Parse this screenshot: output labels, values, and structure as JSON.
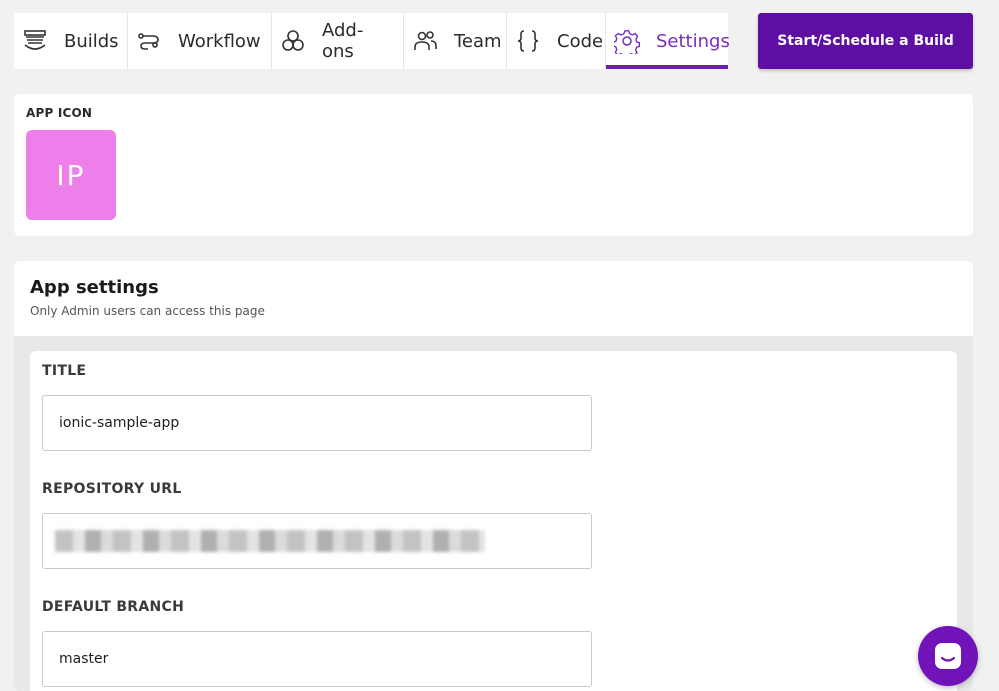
{
  "nav": {
    "tabs": [
      {
        "label": "Builds",
        "icon": "builds-icon"
      },
      {
        "label": "Workflow",
        "icon": "workflow-icon"
      },
      {
        "label": "Add-ons",
        "icon": "addons-icon"
      },
      {
        "label": "Team",
        "icon": "team-icon"
      },
      {
        "label": "Code",
        "icon": "code-icon"
      },
      {
        "label": "Settings",
        "icon": "gear-icon",
        "active": true
      }
    ],
    "build_button": "Start/Schedule a Build"
  },
  "app_icon": {
    "label": "APP ICON",
    "initials": "IP",
    "color": "#ee7ee9"
  },
  "app_settings": {
    "title": "App settings",
    "subtitle": "Only Admin users can access this page",
    "fields": {
      "title_label": "TITLE",
      "title_value": "ionic-sample-app",
      "repo_label": "REPOSITORY URL",
      "branch_label": "DEFAULT BRANCH",
      "branch_value": "master"
    }
  },
  "colors": {
    "accent": "#5e0fa3",
    "active_tab": "#7b2cbf"
  }
}
